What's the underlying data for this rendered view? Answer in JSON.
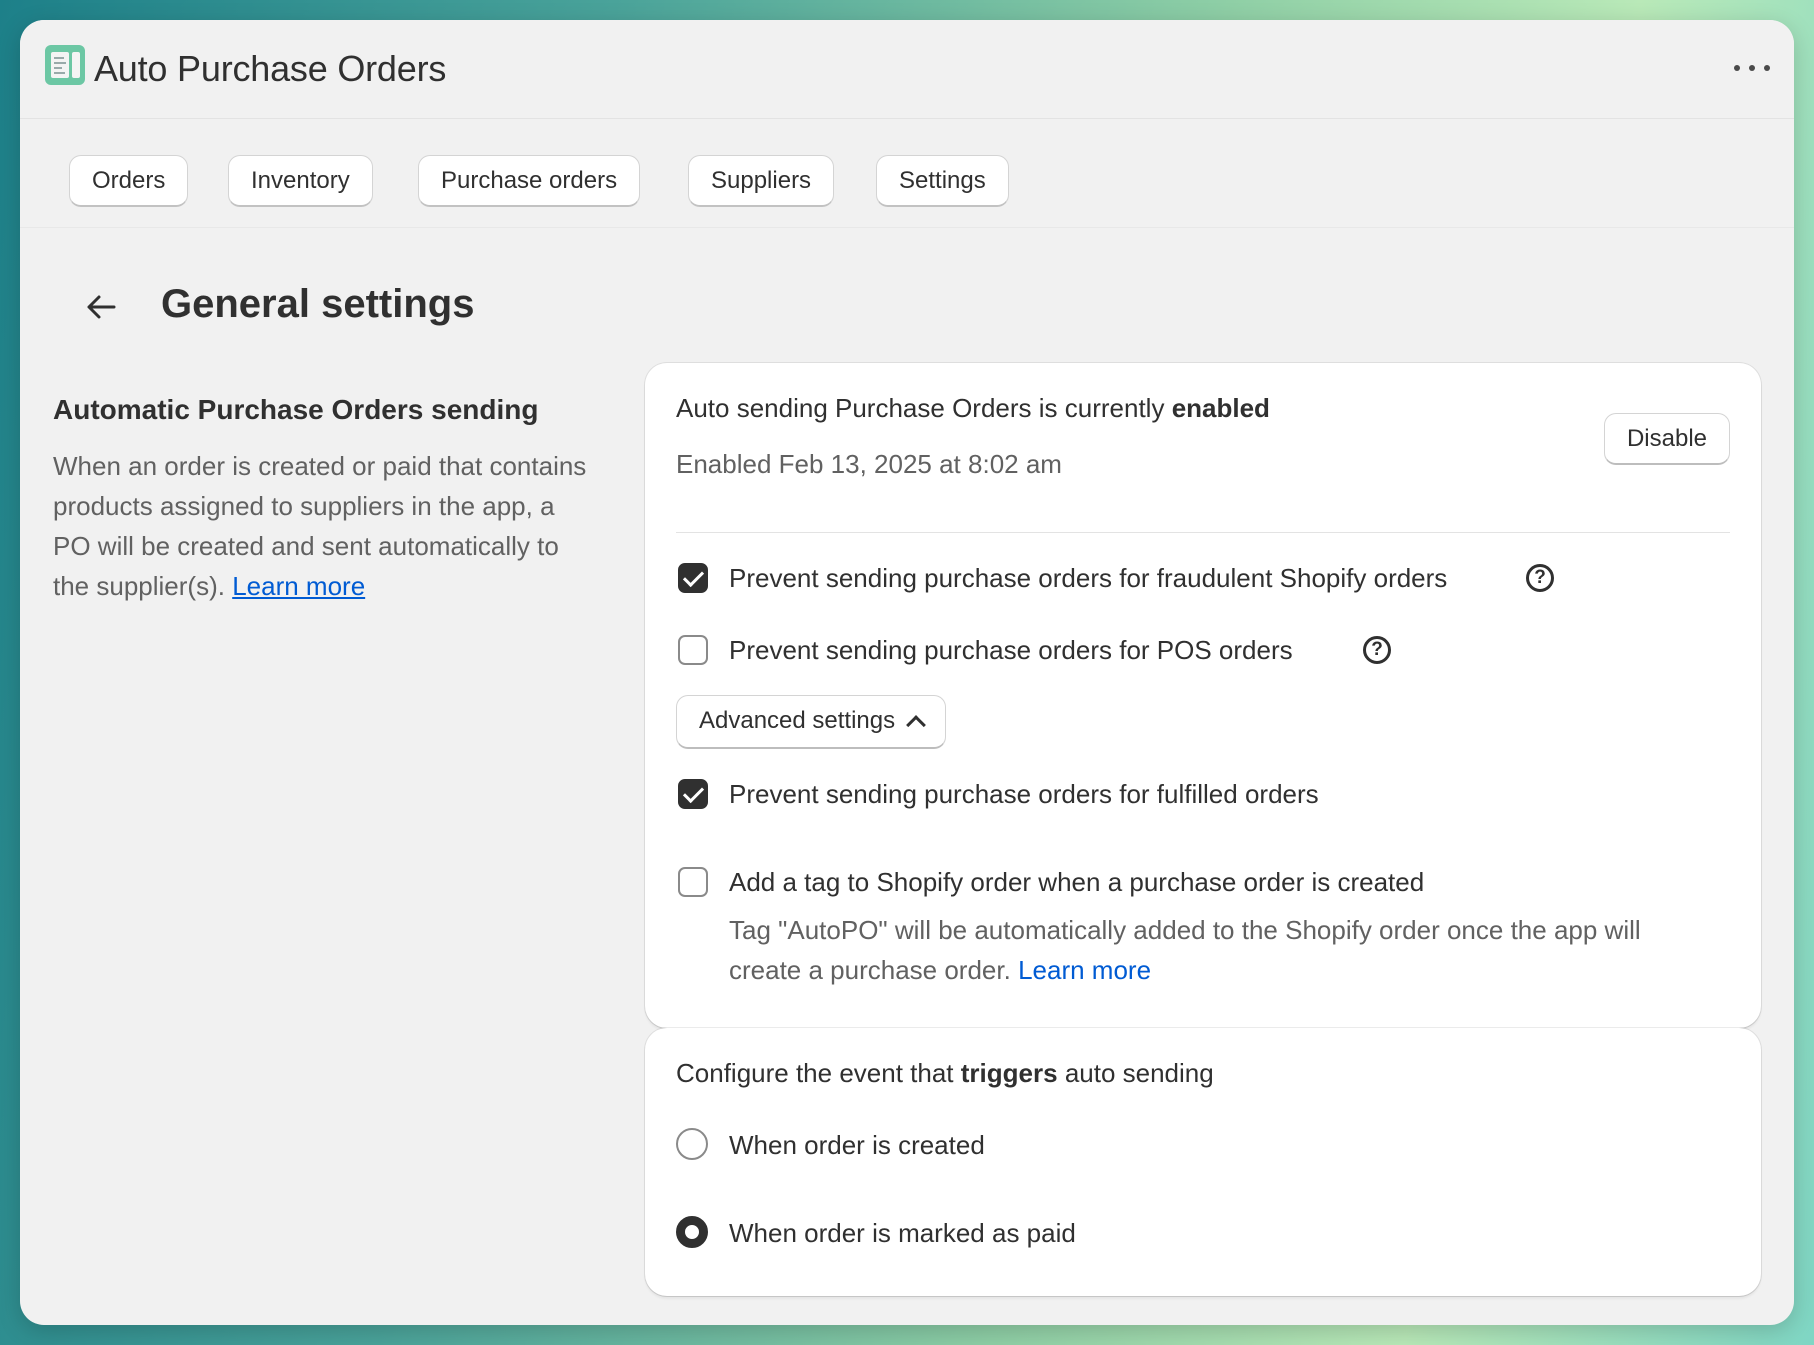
{
  "app": {
    "title": "Auto Purchase Orders",
    "icon": "spreadsheet-app-icon",
    "accent": "#6cc7a4"
  },
  "nav": {
    "items": [
      {
        "label": "Orders"
      },
      {
        "label": "Inventory"
      },
      {
        "label": "Purchase orders"
      },
      {
        "label": "Suppliers"
      },
      {
        "label": "Settings"
      }
    ]
  },
  "page": {
    "title": "General settings"
  },
  "auto_sending": {
    "section_title": "Automatic Purchase Orders sending",
    "section_desc": "When an order is created or paid that contains products assigned to suppliers in the app, a PO will be created and sent automatically to the supplier(s).",
    "learn_more": "Learn more",
    "status_prefix": "Auto sending Purchase Orders is currently",
    "status_value": "enabled",
    "enabled_at": "Enabled Feb 13, 2025 at 8:02 am",
    "disable_label": "Disable",
    "options": [
      {
        "label": "Prevent sending purchase orders for fraudulent Shopify orders",
        "checked": true
      },
      {
        "label": "Prevent sending purchase orders for POS orders",
        "checked": false
      }
    ],
    "advanced_label": "Advanced settings",
    "advanced_options": [
      {
        "label": "Prevent sending purchase orders for fulfilled orders",
        "checked": true
      },
      {
        "label": "Add a tag to Shopify order when a purchase order is created",
        "checked": false,
        "help_line1": "Tag \"AutoPO\" will be automatically added to the Shopify order once the app will",
        "help_line2": "create a purchase order.",
        "help_link": "Learn more"
      }
    ]
  },
  "trigger": {
    "title_prefix": "Configure the event that",
    "title_bold": "triggers",
    "title_suffix": "auto sending",
    "options": [
      {
        "label": "When order is created",
        "selected": false
      },
      {
        "label": "When order is marked as paid",
        "selected": true
      }
    ]
  }
}
